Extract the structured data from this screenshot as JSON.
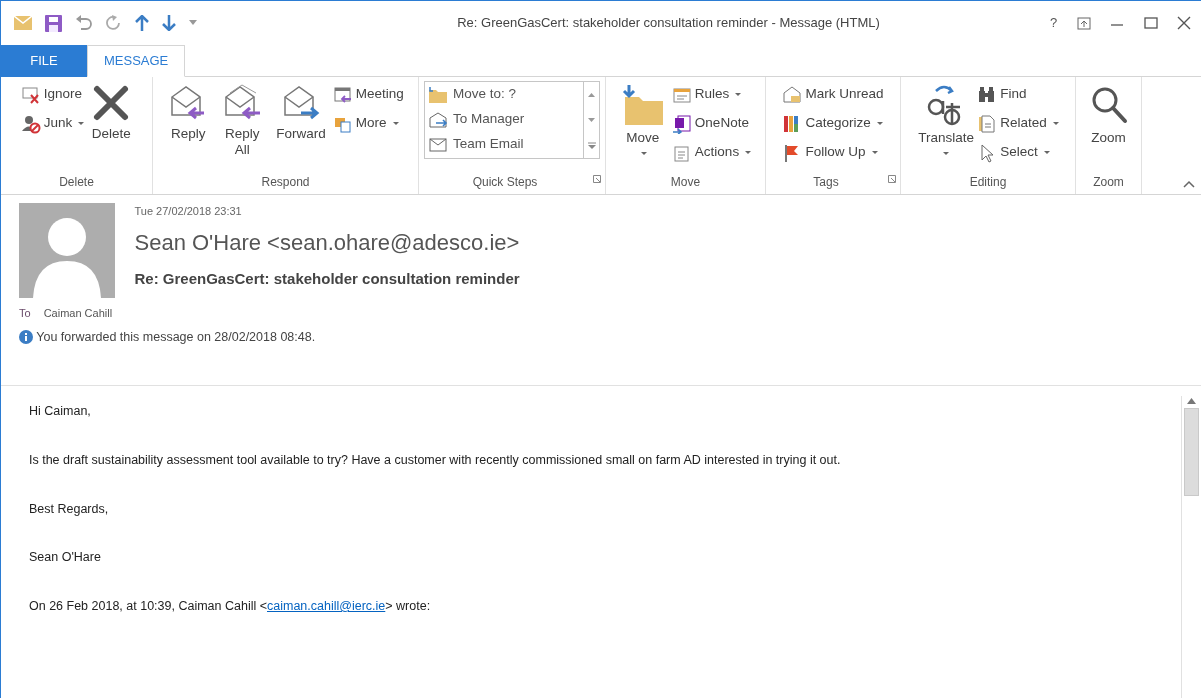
{
  "window": {
    "title": "Re: GreenGasCert: stakeholder consultation reminder - Message (HTML)",
    "help": "?"
  },
  "tabs": [
    {
      "label": "FILE",
      "kind": "file",
      "selected": false
    },
    {
      "label": "MESSAGE",
      "kind": "tab",
      "selected": true
    }
  ],
  "ribbon": [
    {
      "label": "Delete",
      "launcher": false,
      "items": [
        {
          "label": "Ignore",
          "kind": "small",
          "dropdown": false
        },
        {
          "label": "Junk",
          "kind": "small",
          "dropdown": true
        },
        {
          "label": "Delete",
          "kind": "large",
          "dropdown": false
        }
      ]
    },
    {
      "label": "Respond",
      "launcher": false,
      "items": [
        {
          "label": "Reply",
          "kind": "large",
          "dropdown": false
        },
        {
          "label": "Reply All",
          "kind": "large",
          "dropdown": false
        },
        {
          "label": "Forward",
          "kind": "large",
          "dropdown": false
        },
        {
          "label": "Meeting",
          "kind": "small",
          "dropdown": false
        },
        {
          "label": "More",
          "kind": "small",
          "dropdown": true
        }
      ]
    },
    {
      "label": "Quick Steps",
      "launcher": true,
      "items": [
        {
          "label": "Move to: ?",
          "kind": "gallery"
        },
        {
          "label": "To Manager",
          "kind": "gallery"
        },
        {
          "label": "Team Email",
          "kind": "gallery"
        }
      ]
    },
    {
      "label": "Move",
      "launcher": false,
      "items": [
        {
          "label": "Move",
          "kind": "large",
          "dropdown": true
        },
        {
          "label": "Rules",
          "kind": "small",
          "dropdown": true
        },
        {
          "label": "OneNote",
          "kind": "small",
          "dropdown": false
        },
        {
          "label": "Actions",
          "kind": "small",
          "dropdown": true
        }
      ]
    },
    {
      "label": "Tags",
      "launcher": true,
      "items": [
        {
          "label": "Mark Unread",
          "kind": "small",
          "dropdown": false
        },
        {
          "label": "Categorize",
          "kind": "small",
          "dropdown": true
        },
        {
          "label": "Follow Up",
          "kind": "small",
          "dropdown": true
        }
      ]
    },
    {
      "label": "Editing",
      "launcher": false,
      "items": [
        {
          "label": "Translate",
          "kind": "large",
          "dropdown": true
        },
        {
          "label": "Find",
          "kind": "small",
          "dropdown": false
        },
        {
          "label": "Related",
          "kind": "small",
          "dropdown": true
        },
        {
          "label": "Select",
          "kind": "small",
          "dropdown": true
        }
      ]
    },
    {
      "label": "Zoom",
      "launcher": false,
      "items": [
        {
          "label": "Zoom",
          "kind": "large",
          "dropdown": false
        }
      ]
    }
  ],
  "message": {
    "date": "Tue 27/02/2018 23:31",
    "sender": "Sean O'Hare <sean.ohare@adesco.ie>",
    "subject": "Re: GreenGasCert: stakeholder consultation reminder",
    "to_label": "To",
    "to": "Caiman Cahill",
    "info": "You forwarded this message on 28/02/2018 08:48."
  },
  "body": [
    {
      "kind": "text",
      "text": "Hi Caiman,"
    },
    {
      "kind": "text",
      "text": "Is the draft sustainability assessment tool available to try? Have a customer with recently commissioned small on farm AD interested in trying it out."
    },
    {
      "kind": "text",
      "text": "Best Regards,"
    },
    {
      "kind": "text",
      "text": "Sean O'Hare"
    },
    {
      "kind": "quote",
      "before": "On 26 Feb 2018, at 10:39, Caiman Cahill <",
      "link": "caiman.cahill@ierc.ie",
      "after": "> wrote:"
    }
  ]
}
